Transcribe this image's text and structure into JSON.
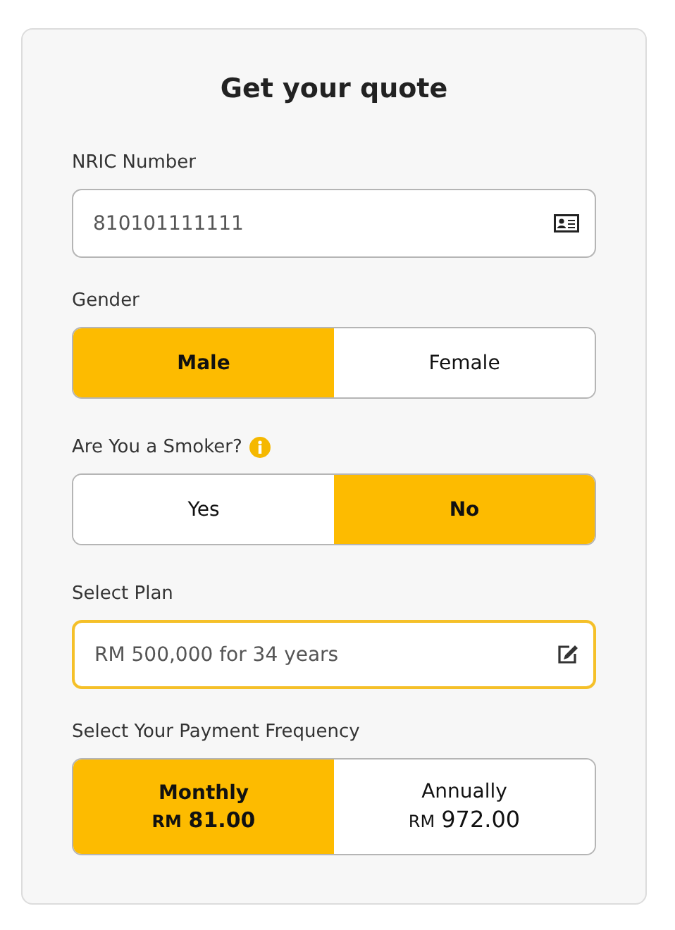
{
  "title": "Get your quote",
  "nric": {
    "label": "NRIC Number",
    "value": "810101111111"
  },
  "gender": {
    "label": "Gender",
    "options": [
      {
        "label": "Male",
        "selected": true
      },
      {
        "label": "Female",
        "selected": false
      }
    ]
  },
  "smoker": {
    "label": "Are You a Smoker?",
    "options": [
      {
        "label": "Yes",
        "selected": false
      },
      {
        "label": "No",
        "selected": true
      }
    ]
  },
  "plan": {
    "label": "Select Plan",
    "value": "RM 500,000 for 34 years",
    "focused": true
  },
  "frequency": {
    "label": "Select Your Payment Frequency",
    "options": [
      {
        "label": "Monthly",
        "currency": "RM",
        "amount": "81.00",
        "selected": true
      },
      {
        "label": "Annually",
        "currency": "RM",
        "amount": "972.00",
        "selected": false
      }
    ]
  }
}
